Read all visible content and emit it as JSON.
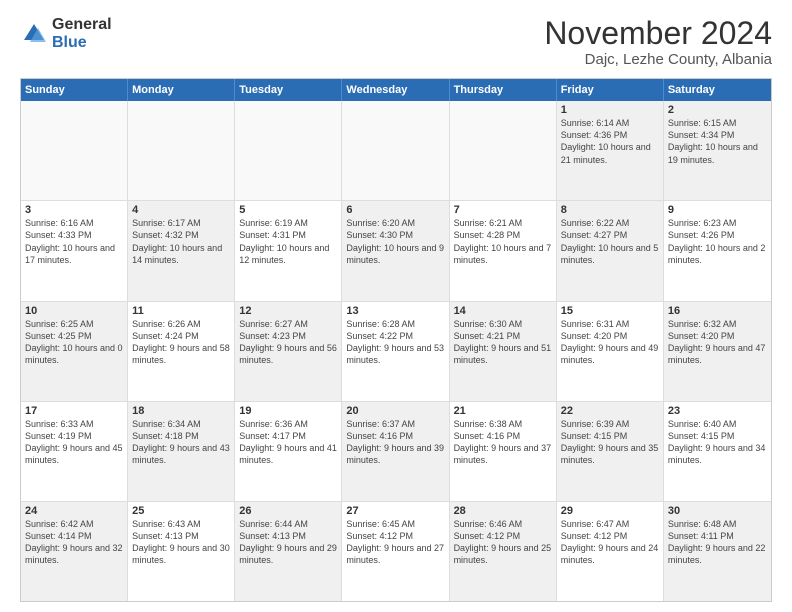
{
  "logo": {
    "general": "General",
    "blue": "Blue"
  },
  "title": "November 2024",
  "location": "Dajc, Lezhe County, Albania",
  "days": [
    "Sunday",
    "Monday",
    "Tuesday",
    "Wednesday",
    "Thursday",
    "Friday",
    "Saturday"
  ],
  "weeks": [
    [
      {
        "day": "",
        "text": "",
        "empty": true
      },
      {
        "day": "",
        "text": "",
        "empty": true
      },
      {
        "day": "",
        "text": "",
        "empty": true
      },
      {
        "day": "",
        "text": "",
        "empty": true
      },
      {
        "day": "",
        "text": "",
        "empty": true
      },
      {
        "day": "1",
        "text": "Sunrise: 6:14 AM\nSunset: 4:36 PM\nDaylight: 10 hours and 21 minutes.",
        "shaded": true
      },
      {
        "day": "2",
        "text": "Sunrise: 6:15 AM\nSunset: 4:34 PM\nDaylight: 10 hours and 19 minutes.",
        "shaded": true
      }
    ],
    [
      {
        "day": "3",
        "text": "Sunrise: 6:16 AM\nSunset: 4:33 PM\nDaylight: 10 hours and 17 minutes."
      },
      {
        "day": "4",
        "text": "Sunrise: 6:17 AM\nSunset: 4:32 PM\nDaylight: 10 hours and 14 minutes.",
        "shaded": true
      },
      {
        "day": "5",
        "text": "Sunrise: 6:19 AM\nSunset: 4:31 PM\nDaylight: 10 hours and 12 minutes."
      },
      {
        "day": "6",
        "text": "Sunrise: 6:20 AM\nSunset: 4:30 PM\nDaylight: 10 hours and 9 minutes.",
        "shaded": true
      },
      {
        "day": "7",
        "text": "Sunrise: 6:21 AM\nSunset: 4:28 PM\nDaylight: 10 hours and 7 minutes."
      },
      {
        "day": "8",
        "text": "Sunrise: 6:22 AM\nSunset: 4:27 PM\nDaylight: 10 hours and 5 minutes.",
        "shaded": true
      },
      {
        "day": "9",
        "text": "Sunrise: 6:23 AM\nSunset: 4:26 PM\nDaylight: 10 hours and 2 minutes."
      }
    ],
    [
      {
        "day": "10",
        "text": "Sunrise: 6:25 AM\nSunset: 4:25 PM\nDaylight: 10 hours and 0 minutes.",
        "shaded": true
      },
      {
        "day": "11",
        "text": "Sunrise: 6:26 AM\nSunset: 4:24 PM\nDaylight: 9 hours and 58 minutes."
      },
      {
        "day": "12",
        "text": "Sunrise: 6:27 AM\nSunset: 4:23 PM\nDaylight: 9 hours and 56 minutes.",
        "shaded": true
      },
      {
        "day": "13",
        "text": "Sunrise: 6:28 AM\nSunset: 4:22 PM\nDaylight: 9 hours and 53 minutes."
      },
      {
        "day": "14",
        "text": "Sunrise: 6:30 AM\nSunset: 4:21 PM\nDaylight: 9 hours and 51 minutes.",
        "shaded": true
      },
      {
        "day": "15",
        "text": "Sunrise: 6:31 AM\nSunset: 4:20 PM\nDaylight: 9 hours and 49 minutes."
      },
      {
        "day": "16",
        "text": "Sunrise: 6:32 AM\nSunset: 4:20 PM\nDaylight: 9 hours and 47 minutes.",
        "shaded": true
      }
    ],
    [
      {
        "day": "17",
        "text": "Sunrise: 6:33 AM\nSunset: 4:19 PM\nDaylight: 9 hours and 45 minutes."
      },
      {
        "day": "18",
        "text": "Sunrise: 6:34 AM\nSunset: 4:18 PM\nDaylight: 9 hours and 43 minutes.",
        "shaded": true
      },
      {
        "day": "19",
        "text": "Sunrise: 6:36 AM\nSunset: 4:17 PM\nDaylight: 9 hours and 41 minutes."
      },
      {
        "day": "20",
        "text": "Sunrise: 6:37 AM\nSunset: 4:16 PM\nDaylight: 9 hours and 39 minutes.",
        "shaded": true
      },
      {
        "day": "21",
        "text": "Sunrise: 6:38 AM\nSunset: 4:16 PM\nDaylight: 9 hours and 37 minutes."
      },
      {
        "day": "22",
        "text": "Sunrise: 6:39 AM\nSunset: 4:15 PM\nDaylight: 9 hours and 35 minutes.",
        "shaded": true
      },
      {
        "day": "23",
        "text": "Sunrise: 6:40 AM\nSunset: 4:15 PM\nDaylight: 9 hours and 34 minutes."
      }
    ],
    [
      {
        "day": "24",
        "text": "Sunrise: 6:42 AM\nSunset: 4:14 PM\nDaylight: 9 hours and 32 minutes.",
        "shaded": true
      },
      {
        "day": "25",
        "text": "Sunrise: 6:43 AM\nSunset: 4:13 PM\nDaylight: 9 hours and 30 minutes."
      },
      {
        "day": "26",
        "text": "Sunrise: 6:44 AM\nSunset: 4:13 PM\nDaylight: 9 hours and 29 minutes.",
        "shaded": true
      },
      {
        "day": "27",
        "text": "Sunrise: 6:45 AM\nSunset: 4:12 PM\nDaylight: 9 hours and 27 minutes."
      },
      {
        "day": "28",
        "text": "Sunrise: 6:46 AM\nSunset: 4:12 PM\nDaylight: 9 hours and 25 minutes.",
        "shaded": true
      },
      {
        "day": "29",
        "text": "Sunrise: 6:47 AM\nSunset: 4:12 PM\nDaylight: 9 hours and 24 minutes."
      },
      {
        "day": "30",
        "text": "Sunrise: 6:48 AM\nSunset: 4:11 PM\nDaylight: 9 hours and 22 minutes.",
        "shaded": true
      }
    ]
  ]
}
